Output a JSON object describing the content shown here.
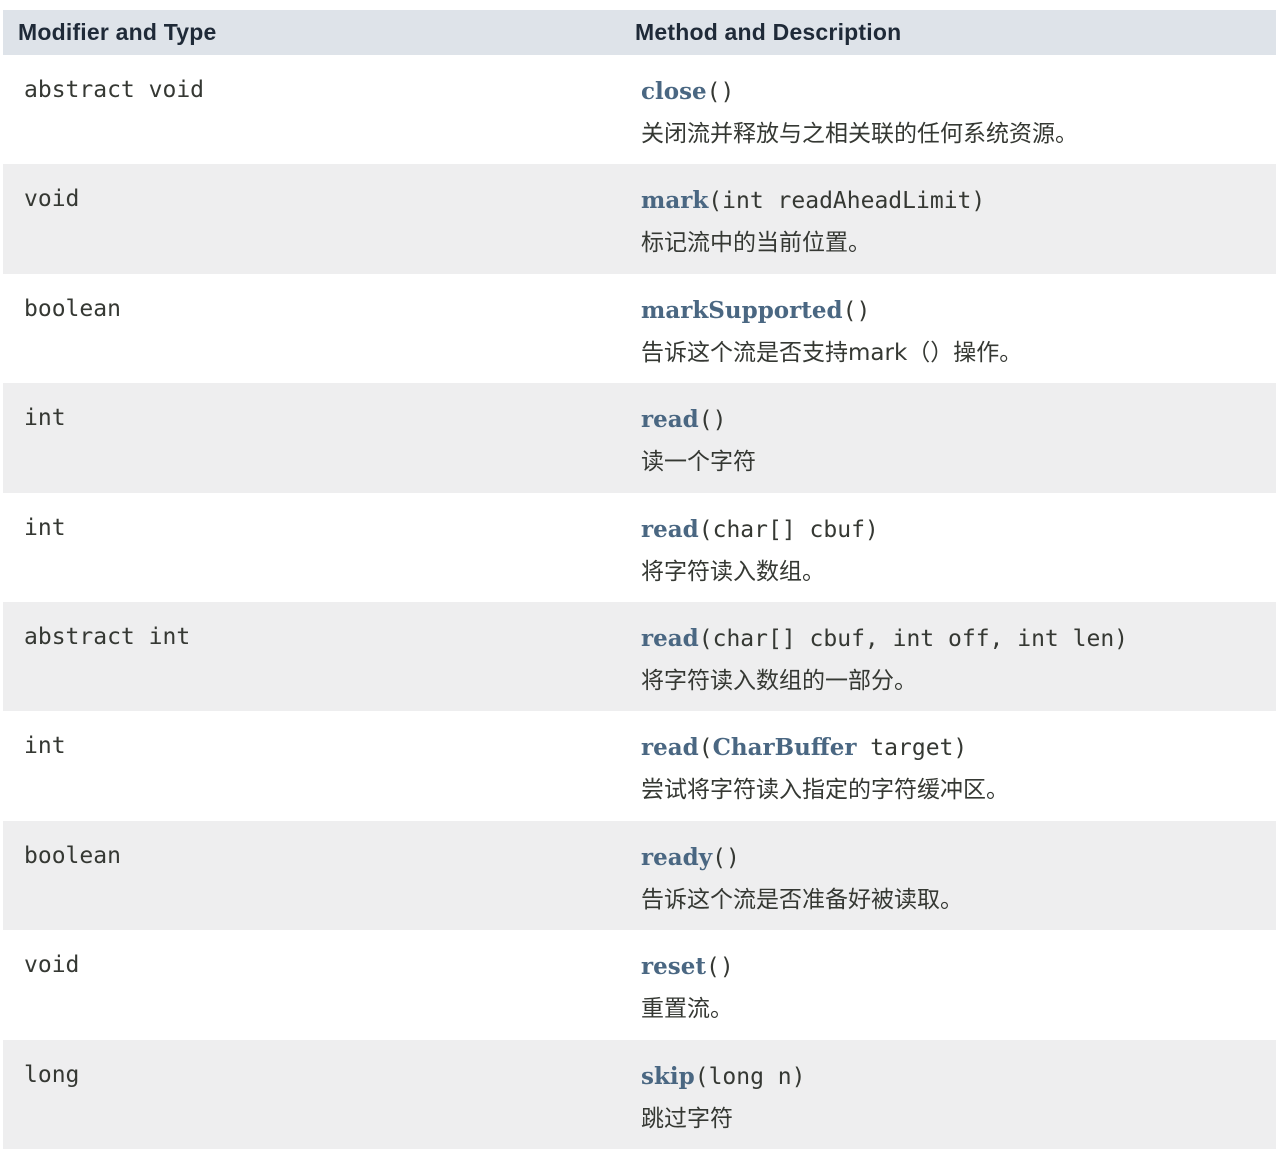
{
  "header": {
    "col_type": "Modifier and Type",
    "col_method": "Method and Description"
  },
  "rows": [
    {
      "type": "abstract void",
      "name": "close",
      "params_pre": "()",
      "link": "",
      "params_post": "",
      "desc": "关闭流并释放与之相关联的任何系统资源。"
    },
    {
      "type": "void",
      "name": "mark",
      "params_pre": "(int readAheadLimit)",
      "link": "",
      "params_post": "",
      "desc": "标记流中的当前位置。"
    },
    {
      "type": "boolean",
      "name": "markSupported",
      "params_pre": "()",
      "link": "",
      "params_post": "",
      "desc": "告诉这个流是否支持mark（）操作。"
    },
    {
      "type": "int",
      "name": "read",
      "params_pre": "()",
      "link": "",
      "params_post": "",
      "desc": "读一个字符"
    },
    {
      "type": "int",
      "name": "read",
      "params_pre": "(char[] cbuf)",
      "link": "",
      "params_post": "",
      "desc": "将字符读入数组。"
    },
    {
      "type": "abstract int",
      "name": "read",
      "params_pre": "(char[] cbuf, int off, int len)",
      "link": "",
      "params_post": "",
      "desc": "将字符读入数组的一部分。"
    },
    {
      "type": "int",
      "name": "read",
      "params_pre": "(",
      "link": "CharBuffer",
      "params_post": " target)",
      "desc": "尝试将字符读入指定的字符缓冲区。"
    },
    {
      "type": "boolean",
      "name": "ready",
      "params_pre": "()",
      "link": "",
      "params_post": "",
      "desc": "告诉这个流是否准备好被读取。"
    },
    {
      "type": "void",
      "name": "reset",
      "params_pre": "()",
      "link": "",
      "params_post": "",
      "desc": "重置流。"
    },
    {
      "type": "long",
      "name": "skip",
      "params_pre": "(long n)",
      "link": "",
      "params_post": "",
      "desc": "跳过字符"
    }
  ]
}
